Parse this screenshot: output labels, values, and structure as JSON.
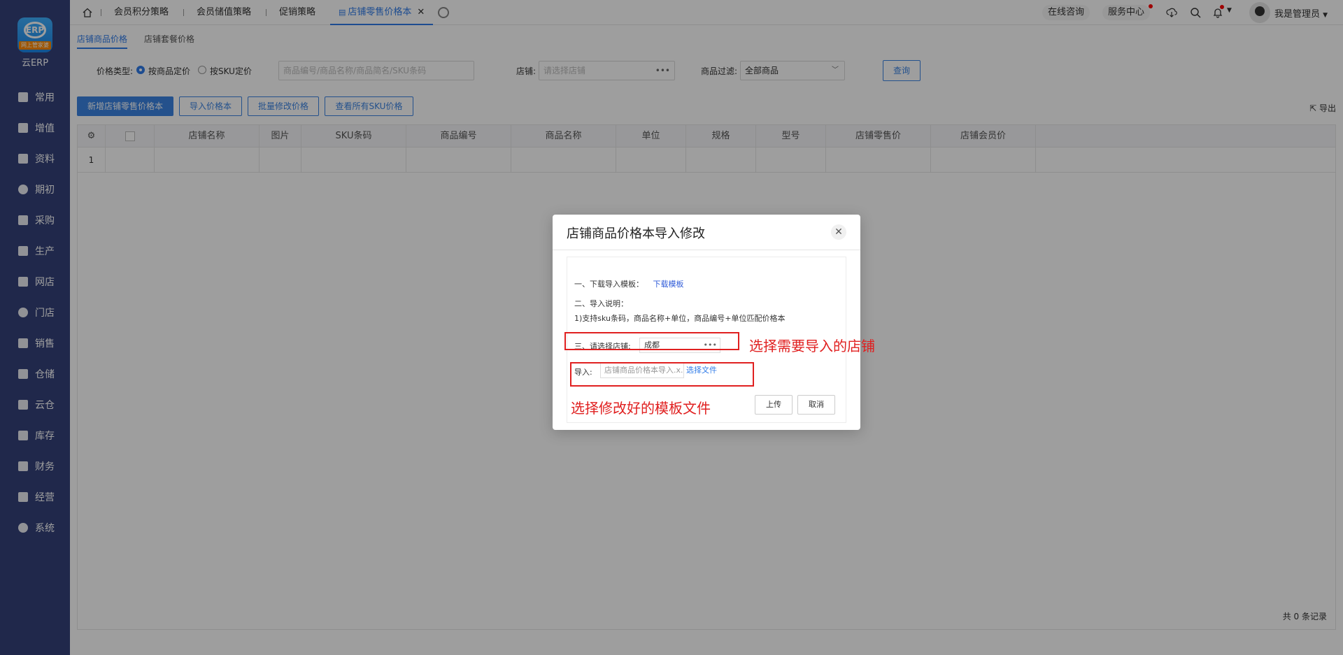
{
  "sidebar": {
    "logo_badge": "网上管家婆",
    "logo_text": "云ERP",
    "items": [
      {
        "label": "常用",
        "icon": "star-icon"
      },
      {
        "label": "增值",
        "icon": "plus-icon"
      },
      {
        "label": "资料",
        "icon": "document-icon"
      },
      {
        "label": "期初",
        "icon": "circle-icon"
      },
      {
        "label": "采购",
        "icon": "cart-icon"
      },
      {
        "label": "生产",
        "icon": "factory-icon"
      },
      {
        "label": "网店",
        "icon": "store-icon"
      },
      {
        "label": "门店",
        "icon": "shop-icon"
      },
      {
        "label": "销售",
        "icon": "chart-icon"
      },
      {
        "label": "仓储",
        "icon": "warehouse-icon"
      },
      {
        "label": "云仓",
        "icon": "cloud-icon"
      },
      {
        "label": "库存",
        "icon": "home-icon"
      },
      {
        "label": "财务",
        "icon": "money-icon"
      },
      {
        "label": "经营",
        "icon": "analysis-icon"
      },
      {
        "label": "系统",
        "icon": "settings-icon"
      }
    ]
  },
  "topbar": {
    "tabs": [
      "会员积分策略",
      "会员储值策略",
      "促销策略",
      "店铺零售价格本"
    ],
    "active_tab": "店铺零售价格本",
    "online_consult": "在线咨询",
    "service_center": "服务中心",
    "user_name": "我是管理员"
  },
  "page": {
    "subtabs": [
      "店铺商品价格",
      "店铺套餐价格"
    ],
    "price_type_label": "价格类型:",
    "radio_product": "按商品定价",
    "radio_sku": "按SKU定价",
    "search_placeholder": "商品编号/商品名称/商品简名/SKU条码",
    "store_label": "店铺:",
    "store_placeholder": "请选择店铺",
    "filter_label": "商品过滤:",
    "filter_value": "全部商品",
    "query_button": "查询",
    "buttons": [
      "新增店铺零售价格本",
      "导入价格本",
      "批量修改价格",
      "查看所有SKU价格"
    ],
    "export_label": "导出",
    "columns": [
      "店铺名称",
      "图片",
      "SKU条码",
      "商品编号",
      "商品名称",
      "单位",
      "规格",
      "型号",
      "店铺零售价",
      "店铺会员价"
    ],
    "row_number": "1",
    "record_count": "共 0 条记录"
  },
  "modal": {
    "title": "店铺商品价格本导入修改",
    "step1_label": "一、下载导入模板：",
    "step1_link": "下载模板",
    "step2_label": "二、导入说明：",
    "step2_desc": "1)支持sku条码，商品名称+单位，商品编号+单位匹配价格本",
    "step3_label": "三、请选择店铺:",
    "step3_value": "成都",
    "import_label": "导入:",
    "import_value": "店铺商品价格本导入.x...",
    "choose_file": "选择文件",
    "upload_button": "上传",
    "cancel_button": "取消"
  },
  "annotations": {
    "store_hint": "选择需要导入的店铺",
    "file_hint": "选择修改好的模板文件"
  }
}
